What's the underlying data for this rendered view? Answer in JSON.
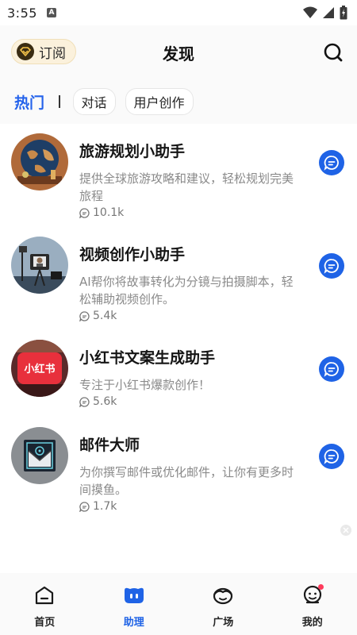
{
  "status_bar": {
    "time": "3:55",
    "notif_glyph": "A",
    "icons": [
      "wifi-icon",
      "signal-icon",
      "battery-icon"
    ]
  },
  "header": {
    "subscribe_label": "订阅",
    "title": "发现",
    "search_icon": "search-icon"
  },
  "tabs": {
    "hot": "热门",
    "chips": [
      "对话",
      "用户创作"
    ]
  },
  "items": [
    {
      "title": "旅游规划小助手",
      "desc": "提供全球旅游攻略和建议，轻松规划完美旅程",
      "count": "10.1k"
    },
    {
      "title": "视频创作小助手",
      "desc": "AI帮你将故事转化为分镜与拍摄脚本，轻松辅助视频创作。",
      "count": "5.4k"
    },
    {
      "title": "小红书文案生成助手",
      "desc": "专注于小红书爆款创作！",
      "count": "5.6k",
      "logo_text": "小红书"
    },
    {
      "title": "邮件大师",
      "desc": "为你撰写邮件或优化邮件，让你有更多时间摸鱼。",
      "count": "1.7k"
    }
  ],
  "bottom_nav": [
    {
      "label": "首页",
      "icon": "home-icon",
      "active": false
    },
    {
      "label": "助理",
      "icon": "assistant-icon",
      "active": true
    },
    {
      "label": "广场",
      "icon": "plaza-icon",
      "active": false
    },
    {
      "label": "我的",
      "icon": "profile-icon",
      "active": false
    }
  ],
  "colors": {
    "accent": "#1f63e6",
    "hot_tab": "#2563eb",
    "badge": "#ff3b5c",
    "subscribe_bg": "#fbf1dc"
  }
}
